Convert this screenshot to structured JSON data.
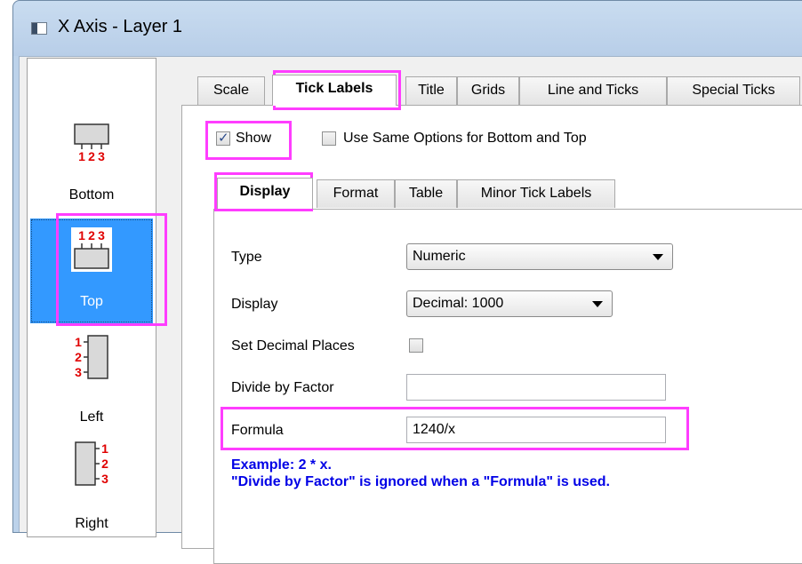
{
  "window": {
    "title": "X Axis - Layer 1"
  },
  "side_panel": {
    "items": [
      {
        "label": "Bottom",
        "selected": false
      },
      {
        "label": "Top",
        "selected": true
      },
      {
        "label": "Left",
        "selected": false
      },
      {
        "label": "Right",
        "selected": false
      }
    ],
    "tick_digits": [
      "1",
      "2",
      "3"
    ]
  },
  "main_tabs": [
    "Scale",
    "Tick Labels",
    "Title",
    "Grids",
    "Line and Ticks",
    "Special Ticks"
  ],
  "main_tab_active": "Tick Labels",
  "show_checkbox": {
    "label": "Show",
    "checked": true
  },
  "same_options_checkbox": {
    "label": "Use Same Options for Bottom and Top",
    "checked": false
  },
  "sub_tabs": [
    "Display",
    "Format",
    "Table",
    "Minor Tick Labels"
  ],
  "sub_tab_active": "Display",
  "form": {
    "type_label": "Type",
    "type_value": "Numeric",
    "display_label": "Display",
    "display_value": "Decimal: 1000",
    "decimal_places_label": "Set Decimal Places",
    "decimal_places_checked": false,
    "divide_label": "Divide by Factor",
    "divide_value": "",
    "formula_label": "Formula",
    "formula_value": "1240/x"
  },
  "notes": {
    "example": "Example: 2 * x.",
    "ignored": "\"Divide by Factor\" is ignored when a \"Formula\" is used."
  },
  "colors": {
    "highlight": "#ff3dff",
    "selection": "#3399ff",
    "note_text": "#0000e6",
    "tick_digits": "#e00000"
  }
}
